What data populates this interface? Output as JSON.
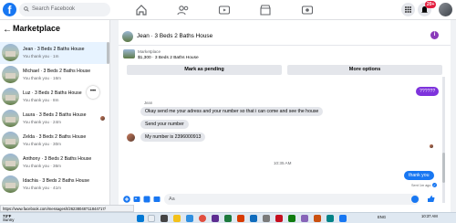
{
  "topbar": {
    "logo": "f",
    "search_placeholder": "Search Facebook",
    "notification_badge": "20+",
    "nav_icons": [
      "home-icon",
      "friends-icon",
      "watch-icon",
      "marketplace-icon",
      "groups-icon"
    ],
    "accent_color": "#1877f2"
  },
  "left": {
    "back_arrow": "←",
    "title": "Marketplace",
    "more_dots": "•••",
    "conversations": [
      {
        "title": "Jean · 3 Beds 2 Baths House",
        "sub": "You thank you · 1m",
        "active": true
      },
      {
        "title": "Michael · 3 Beds 2 Baths House",
        "sub": "You thank you · 16m"
      },
      {
        "title": "Luz · 3 Beds 2 Baths House",
        "sub": "You thank you · 8m"
      },
      {
        "title": "Laura · 3 Beds 2 Baths House",
        "sub": "You thank you · 24m"
      },
      {
        "title": "Zelda · 3 Beds 2 Baths House",
        "sub": "You thank you · 30m"
      },
      {
        "title": "Anthony · 3 Beds 2 Baths House",
        "sub": "You thank you · 36m"
      },
      {
        "title": "Idachia · 3 Beds 2 Baths House",
        "sub": "You thank you · 41m"
      }
    ]
  },
  "chat": {
    "contact_name": "Jean · 3 Beds 2 Baths House",
    "info_icon": "i",
    "listing_label": "Marketplace",
    "listing_price_title": "$1,300 · 3 Beds 2 Baths House",
    "mark_pending_label": "Mark as pending",
    "more_options_label": "More options",
    "sent_bubble_top": "??????",
    "sender_label": "Jean",
    "messages": [
      "Okay send me your adress and your number so that i can come and see the house",
      "Send your number",
      "My number is 2396000913"
    ],
    "timestamp": "10:35 AM",
    "last_sent": "thank you",
    "sent_status": "Sent 1m ago",
    "composer_placeholder": "Aa",
    "sent_bubble_color": "#7e33dc"
  },
  "statusbar": {
    "url": "https://www.facebook.com/messages/t/26238048711844717/"
  },
  "taskbar": {
    "temperature": "73°F",
    "condition": "Sunny",
    "time": "10:37 AM",
    "date": "",
    "tray_text": "ENG"
  }
}
